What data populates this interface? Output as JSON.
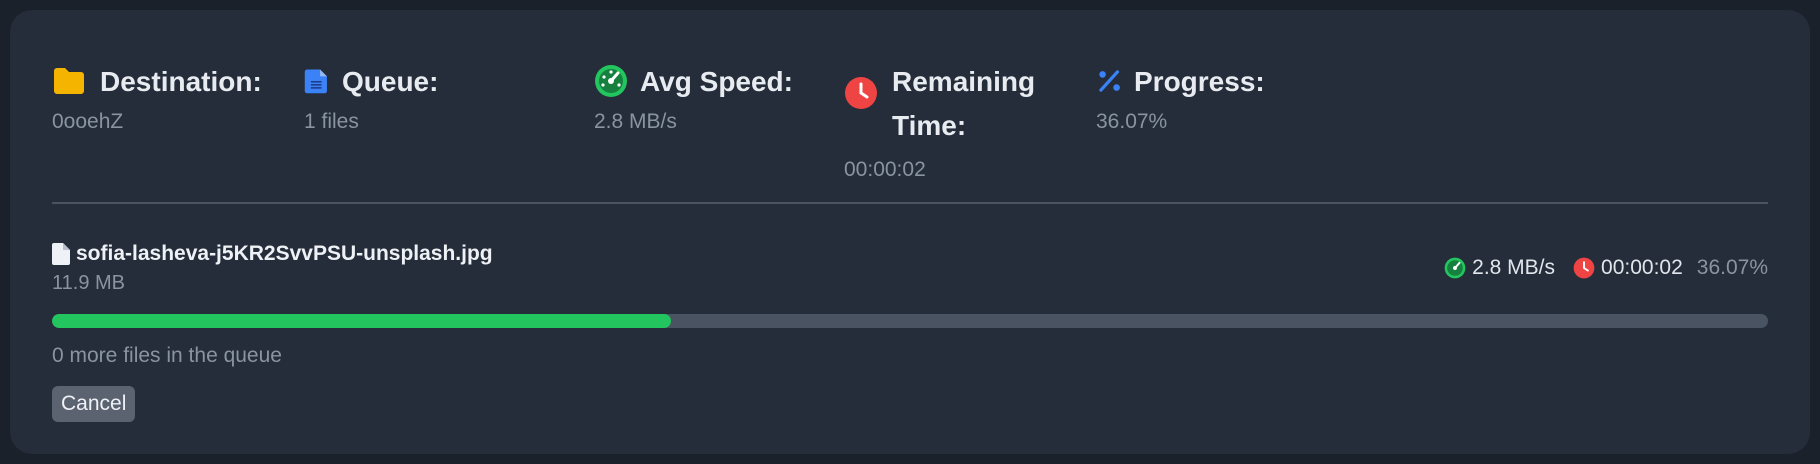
{
  "colors": {
    "page_bg": "#1b212b",
    "panel_bg": "#252d3a",
    "folder_icon": "#f4b400",
    "file_icon": "#3b82f6",
    "speed_icon": "#22c55e",
    "clock_icon": "#ef4444",
    "percent_icon": "#3b82f6",
    "progress_fill": "#22c55e",
    "progress_track": "#4a5361"
  },
  "stats": {
    "destination": {
      "label": "Destination:",
      "value": "0ooehZ",
      "icon": "folder-icon"
    },
    "queue": {
      "label": "Queue:",
      "value": "1 files",
      "icon": "file-icon"
    },
    "avg_speed": {
      "label": "Avg Speed:",
      "value": "2.8 MB/s",
      "icon": "gauge-icon"
    },
    "remaining": {
      "label_line1": "Remaining",
      "label_line2": "Time:",
      "value": "00:00:02",
      "icon": "clock-icon"
    },
    "progress": {
      "label": "Progress:",
      "value": "36.07%",
      "icon": "percent-icon"
    }
  },
  "file": {
    "name": "sofia-lasheva-j5KR2SvvPSU-unsplash.jpg",
    "size": "11.9 MB",
    "speed": "2.8 MB/s",
    "remaining": "00:00:02",
    "percent": "36.07%",
    "progress_fraction": 0.3607
  },
  "queue_note": "0 more files in the queue",
  "cancel_label": "Cancel"
}
